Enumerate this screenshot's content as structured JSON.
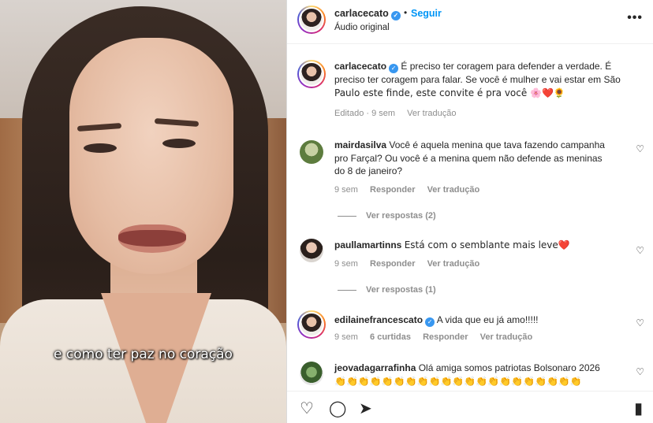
{
  "video": {
    "caption": "e como ter paz no coração"
  },
  "header": {
    "username": "carlacecato",
    "dot": "•",
    "follow_label": "Seguir",
    "audio": "Áudio original",
    "more_icon": "more-horizontal-icon",
    "more_glyph": "•••"
  },
  "post": {
    "username": "carlacecato",
    "text_line1": "É preciso ter coragem para defender a verdade. É",
    "text_line2": "preciso ter coragem para falar. Se você é mulher e vai estar em São",
    "text_line3": "Paulo este finde, este convite é pra você 🌸❤️🌻",
    "edited": "Editado · 9 sem",
    "see_translation": "Ver tradução"
  },
  "comments": [
    {
      "username": "mairdasilva",
      "text_line1": "Você é aquela menina que tava fazendo campanha",
      "text_line2": "pro Farçal? Ou você é a menina quem não defende as meninas",
      "text_line3": "do 8 de janeiro?",
      "time": "9 sem",
      "reply": "Responder",
      "translate": "Ver tradução",
      "view_replies": "Ver respostas (2)"
    },
    {
      "username": "paullamartinns",
      "text": "Está com o semblante mais leve❤️",
      "time": "9 sem",
      "reply": "Responder",
      "translate": "Ver tradução",
      "view_replies": "Ver respostas (1)"
    },
    {
      "username": "edilainefrancescato",
      "text": "A vida que eu já amo!!!!!",
      "time": "9 sem",
      "likes": "6 curtidas",
      "reply": "Responder",
      "translate": "Ver tradução"
    },
    {
      "username": "jeovadagarrafinha",
      "text": "Olá amiga somos patriotas Bolsonaro 2026",
      "text_line2": "👏👏👏👏👏👏👏👏👏👏👏👏👏👏👏👏👏👏👏👏👏"
    }
  ],
  "icons": {
    "heart": "♡",
    "like": "♡",
    "comment": "◯",
    "share": "➤",
    "save": "▮",
    "verified": "✓"
  },
  "colors": {
    "link_blue": "#0095f6",
    "verified_blue": "#3897f0",
    "muted": "#8e8e8e"
  }
}
